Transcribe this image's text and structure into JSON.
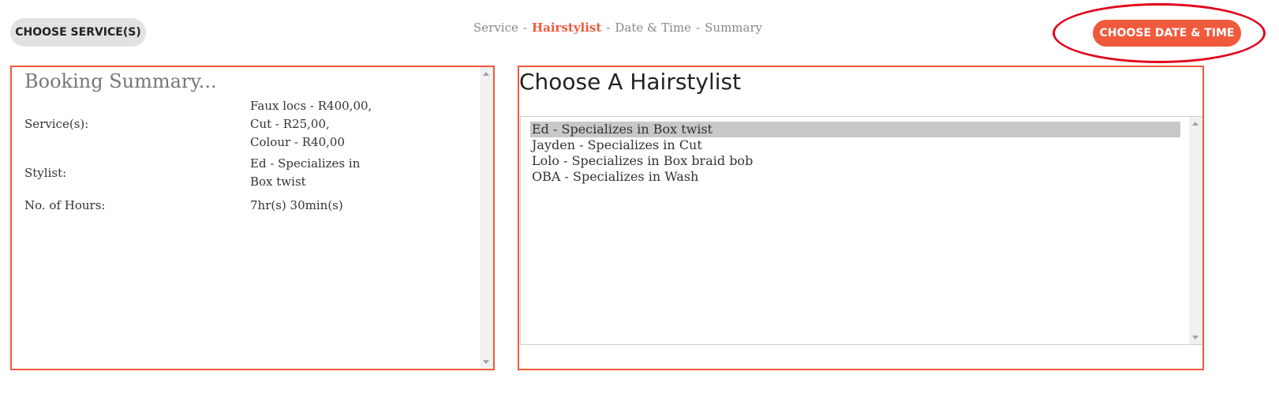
{
  "nav": {
    "back_label": "CHOOSE SERVICE(S)",
    "next_label": "CHOOSE DATE & TIME",
    "steps": [
      "Service",
      "Hairstylist",
      "Date & Time",
      "Summary"
    ],
    "active_step": "Hairstylist",
    "separator": "-"
  },
  "summary": {
    "title": "Booking Summary...",
    "services_label": "Service(s):",
    "services": [
      "Faux locs - R400,00,",
      "Cut - R25,00,",
      "Colour - R40,00"
    ],
    "stylist_label": "Stylist:",
    "stylist_lines": [
      "Ed - Specializes in",
      "Box twist"
    ],
    "hours_label": "No. of Hours:",
    "hours_value": "7hr(s) 30min(s)"
  },
  "stylists": {
    "title": "Choose A Hairstylist",
    "selected_index": 0,
    "options": [
      "Ed - Specializes in Box twist",
      "Jayden - Specializes in Cut",
      "Lolo - Specializes in Box braid bob",
      "OBA - Specializes in Wash"
    ]
  },
  "colors": {
    "accent": "#f05a3c",
    "annotation": "#e2001a",
    "back_button_bg": "#e2e2e2",
    "selected_option_bg": "#c8c8c8"
  }
}
